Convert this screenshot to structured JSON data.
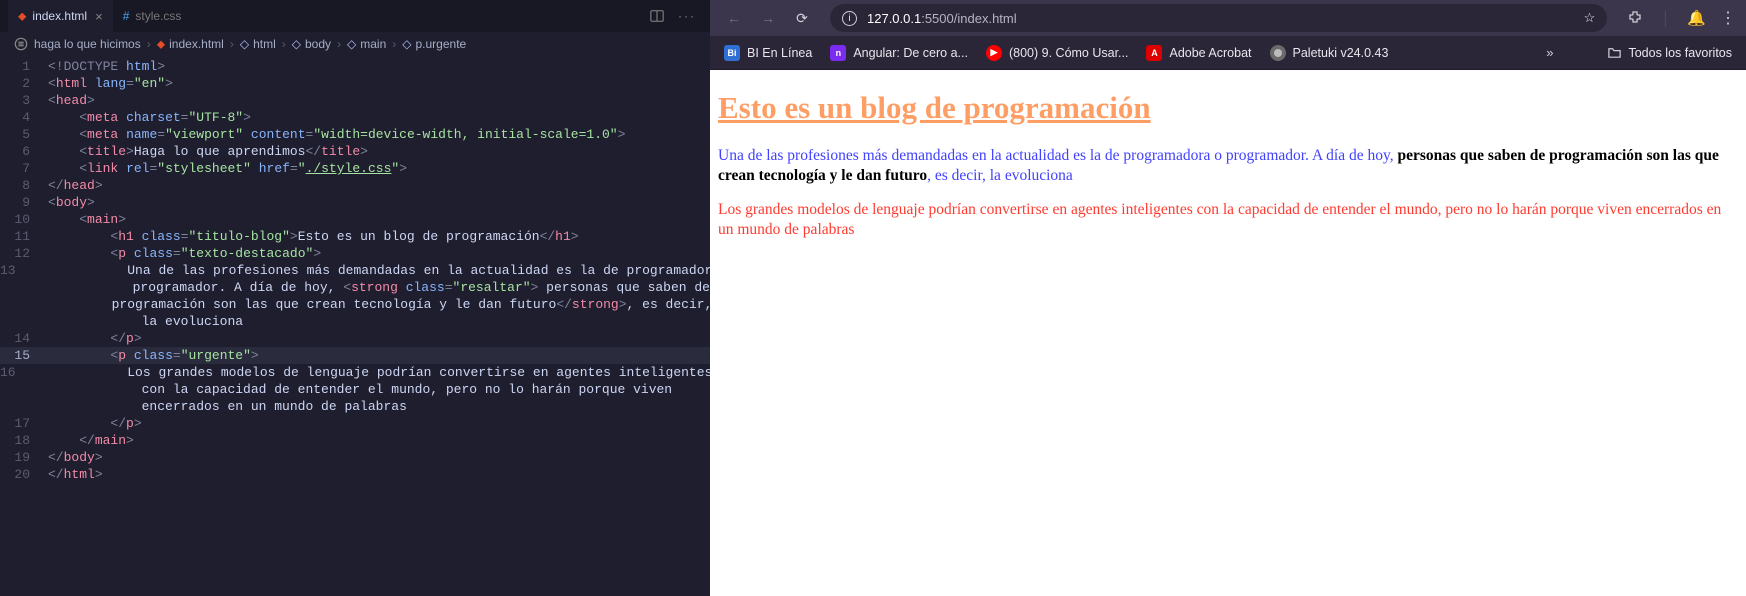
{
  "tabs": [
    {
      "label": "index.html",
      "icon": "html",
      "active": true
    },
    {
      "label": "style.css",
      "icon": "css",
      "active": false
    }
  ],
  "breadcrumbs": {
    "root": "haga lo que hicimos",
    "items": [
      "index.html",
      "html",
      "body",
      "main",
      "p.urgente"
    ]
  },
  "code_lines": [
    {
      "n": 1,
      "html": "<span class='p'>&lt;!</span><span class='d'>DOCTYPE</span><span class='tx'> </span><span class='a'>html</span><span class='p'>&gt;</span>"
    },
    {
      "n": 2,
      "html": "<span class='p'>&lt;</span><span class='t'>html</span><span class='tx'> </span><span class='a'>lang</span><span class='p'>=</span><span class='s'>\"en\"</span><span class='p'>&gt;</span>"
    },
    {
      "n": 3,
      "html": "<span class='p'>&lt;</span><span class='t'>head</span><span class='p'>&gt;</span>"
    },
    {
      "n": 4,
      "html": "    <span class='p'>&lt;</span><span class='t'>meta</span><span class='tx'> </span><span class='a'>charset</span><span class='p'>=</span><span class='s'>\"UTF-8\"</span><span class='p'>&gt;</span>"
    },
    {
      "n": 5,
      "html": "    <span class='p'>&lt;</span><span class='t'>meta</span><span class='tx'> </span><span class='a'>name</span><span class='p'>=</span><span class='s'>\"viewport\"</span><span class='tx'> </span><span class='a'>content</span><span class='p'>=</span><span class='s'>\"width=device-width, initial-scale=1.0\"</span><span class='p'>&gt;</span>"
    },
    {
      "n": 6,
      "html": "    <span class='p'>&lt;</span><span class='t'>title</span><span class='p'>&gt;</span><span class='tx'>Haga lo que aprendimos</span><span class='p'>&lt;/</span><span class='t'>title</span><span class='p'>&gt;</span>"
    },
    {
      "n": 7,
      "html": "    <span class='p'>&lt;</span><span class='t'>link</span><span class='tx'> </span><span class='a'>rel</span><span class='p'>=</span><span class='s'>\"stylesheet\"</span><span class='tx'> </span><span class='a'>href</span><span class='p'>=</span><span class='s'>\"</span><span class='u'>./style.css</span><span class='s'>\"</span><span class='p'>&gt;</span>"
    },
    {
      "n": 8,
      "html": "<span class='p'>&lt;/</span><span class='t'>head</span><span class='p'>&gt;</span>"
    },
    {
      "n": 9,
      "html": "<span class='p'>&lt;</span><span class='t'>body</span><span class='p'>&gt;</span>"
    },
    {
      "n": 10,
      "html": "    <span class='p'>&lt;</span><span class='t'>main</span><span class='p'>&gt;</span>"
    },
    {
      "n": 11,
      "html": "        <span class='p'>&lt;</span><span class='t'>h1</span><span class='tx'> </span><span class='a'>class</span><span class='p'>=</span><span class='s'>\"titulo-blog\"</span><span class='p'>&gt;</span><span class='tx'>Esto es un blog de programación</span><span class='p'>&lt;/</span><span class='t'>h1</span><span class='p'>&gt;</span>"
    },
    {
      "n": 12,
      "html": "        <span class='p'>&lt;</span><span class='t'>p</span><span class='tx'> </span><span class='a'>class</span><span class='p'>=</span><span class='s'>\"texto-destacado\"</span><span class='p'>&gt;</span>"
    },
    {
      "n": 13,
      "html": "            <span class='tx'>Una de las profesiones más demandadas en la actualidad es la de programadora o</span>\n            <span class='tx'>programador. A día de hoy, </span><span class='p'>&lt;</span><span class='t'>strong</span><span class='tx'> </span><span class='a'>class</span><span class='p'>=</span><span class='s'>\"resaltar\"</span><span class='p'>&gt;</span><span class='tx'> personas que saben de</span>\n            <span class='tx'>programación son las que crean tecnología y le dan futuro</span><span class='p'>&lt;/</span><span class='t'>strong</span><span class='p'>&gt;</span><span class='tx'>, es decir,</span>\n            <span class='tx'>la evoluciona</span>"
    },
    {
      "n": 14,
      "html": "        <span class='p'>&lt;/</span><span class='t'>p</span><span class='p'>&gt;</span>"
    },
    {
      "n": 15,
      "hl": true,
      "html": "        <span class='p'>&lt;</span><span class='t'>p</span><span class='tx'> </span><span class='a'>class</span><span class='p'>=</span><span class='s'>\"urgente\"</span><span class='p'>&gt;</span>"
    },
    {
      "n": 16,
      "html": "            <span class='tx'>Los grandes modelos de lenguaje podrían convertirse en agentes inteligentes</span>\n            <span class='tx'>con la capacidad de entender el mundo, pero no lo harán porque viven</span>\n            <span class='tx'>encerrados en un mundo de palabras</span>"
    },
    {
      "n": 17,
      "html": "        <span class='p'>&lt;/</span><span class='t'>p</span><span class='p'>&gt;</span>"
    },
    {
      "n": 18,
      "html": "    <span class='p'>&lt;/</span><span class='t'>main</span><span class='p'>&gt;</span>"
    },
    {
      "n": 19,
      "html": "<span class='p'>&lt;/</span><span class='t'>body</span><span class='p'>&gt;</span>"
    },
    {
      "n": 20,
      "html": "<span class='p'>&lt;/</span><span class='t'>html</span><span class='p'>&gt;</span>"
    }
  ],
  "browser": {
    "url_host": "127.0.0.1",
    "url_port": ":5500",
    "url_path": "/index.html",
    "bookmarks": [
      {
        "label": "BI En Línea",
        "favicon": "bi"
      },
      {
        "label": "Angular: De cero a...",
        "favicon": "ng"
      },
      {
        "label": "(800) 9. Cómo Usar...",
        "favicon": "yt"
      },
      {
        "label": "Adobe Acrobat",
        "favicon": "ad"
      },
      {
        "label": "Paletuki v24.0.43",
        "favicon": "pl"
      }
    ],
    "all_bookmarks": "Todos los favoritos"
  },
  "page": {
    "title": "Esto es un blog de programación",
    "p1_a": "Una de las profesiones más demandadas en la actualidad es la de programadora o programador. A día de hoy, ",
    "p1_strong": "personas que saben de programación son las que crean tecnología y le dan futuro",
    "p1_b": ", es decir, la evoluciona",
    "p2": "Los grandes modelos de lenguaje podrían convertirse en agentes inteligentes con la capacidad de entender el mundo, pero no lo harán porque viven encerrados en un mundo de palabras"
  }
}
